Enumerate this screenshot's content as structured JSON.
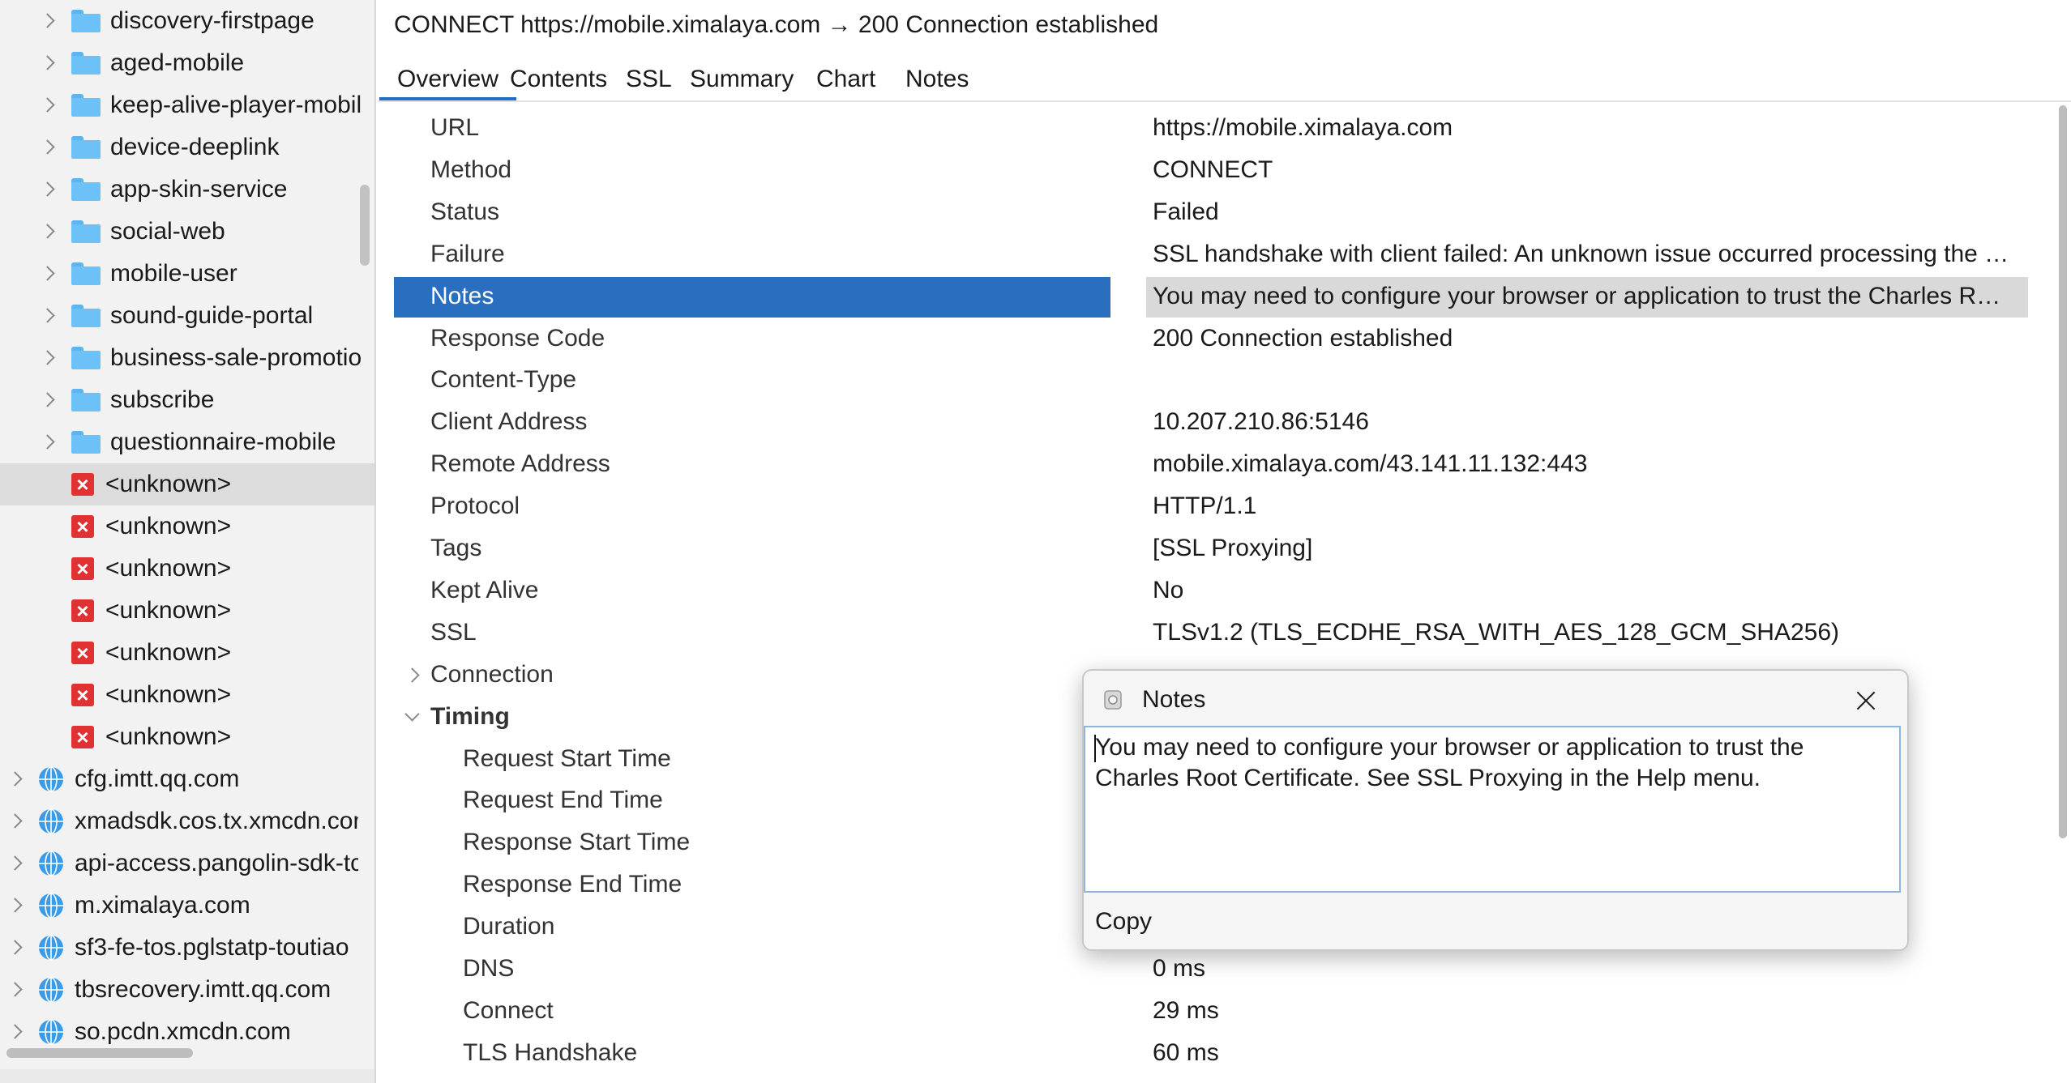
{
  "tree": {
    "folders": [
      "discovery-firstpage",
      "aged-mobile",
      "keep-alive-player-mobil",
      "device-deeplink",
      "app-skin-service",
      "social-web",
      "mobile-user",
      "sound-guide-portal",
      "business-sale-promotio",
      "subscribe",
      "questionnaire-mobile"
    ],
    "unknown_label": "<unknown>",
    "unknown_count": 7,
    "hosts": [
      "cfg.imtt.qq.com",
      "xmadsdk.cos.tx.xmcdn.com",
      "api-access.pangolin-sdk-tc",
      "m.ximalaya.com",
      "sf3-fe-tos.pglstatp-toutiao",
      "tbsrecovery.imtt.qq.com",
      "so.pcdn.xmcdn.com"
    ]
  },
  "header": {
    "title": "CONNECT https://mobile.ximalaya.com → 200 Connection established"
  },
  "tabs": [
    "Overview",
    "Contents",
    "SSL",
    "Summary",
    "Chart",
    "Notes"
  ],
  "overview": {
    "rows": [
      {
        "key": "URL",
        "value": "https://mobile.ximalaya.com"
      },
      {
        "key": "Method",
        "value": "CONNECT"
      },
      {
        "key": "Status",
        "value": "Failed"
      },
      {
        "key": "Failure",
        "value": "SSL handshake with client failed: An unknown issue occurred processing the cer..."
      },
      {
        "key": "Notes",
        "value": "You may need to configure your browser or application to trust the Charles Root..."
      },
      {
        "key": "Response Code",
        "value": "200 Connection established"
      },
      {
        "key": "Content-Type",
        "value": ""
      },
      {
        "key": "Client Address",
        "value": "10.207.210.86:5146"
      },
      {
        "key": "Remote Address",
        "value": "mobile.ximalaya.com/43.141.11.132:443"
      },
      {
        "key": "Protocol",
        "value": "HTTP/1.1"
      },
      {
        "key": "Tags",
        "value": "[SSL Proxying]"
      },
      {
        "key": "Kept Alive",
        "value": "No"
      },
      {
        "key": "SSL",
        "value": "TLSv1.2 (TLS_ECDHE_RSA_WITH_AES_128_GCM_SHA256)"
      },
      {
        "key": "Connection",
        "value": ""
      },
      {
        "key": "Timing",
        "value": ""
      },
      {
        "key": "Request Start Time",
        "value": ""
      },
      {
        "key": "Request End Time",
        "value": ""
      },
      {
        "key": "Response Start Time",
        "value": ""
      },
      {
        "key": "Response End Time",
        "value": ""
      },
      {
        "key": "Duration",
        "value": ""
      },
      {
        "key": "DNS",
        "value": "0 ms"
      },
      {
        "key": "Connect",
        "value": "29 ms"
      },
      {
        "key": "TLS Handshake",
        "value": "60 ms"
      }
    ]
  },
  "dialog": {
    "title": "Notes",
    "text": "You may need to configure your browser or application to trust the Charles Root Certificate. See SSL Proxying in the Help menu.",
    "copy_label": "Copy"
  },
  "colors": {
    "selection": "#2a6fbf",
    "folder": "#6cc1f7",
    "error": "#e03232",
    "globe": "#3a9be8"
  }
}
